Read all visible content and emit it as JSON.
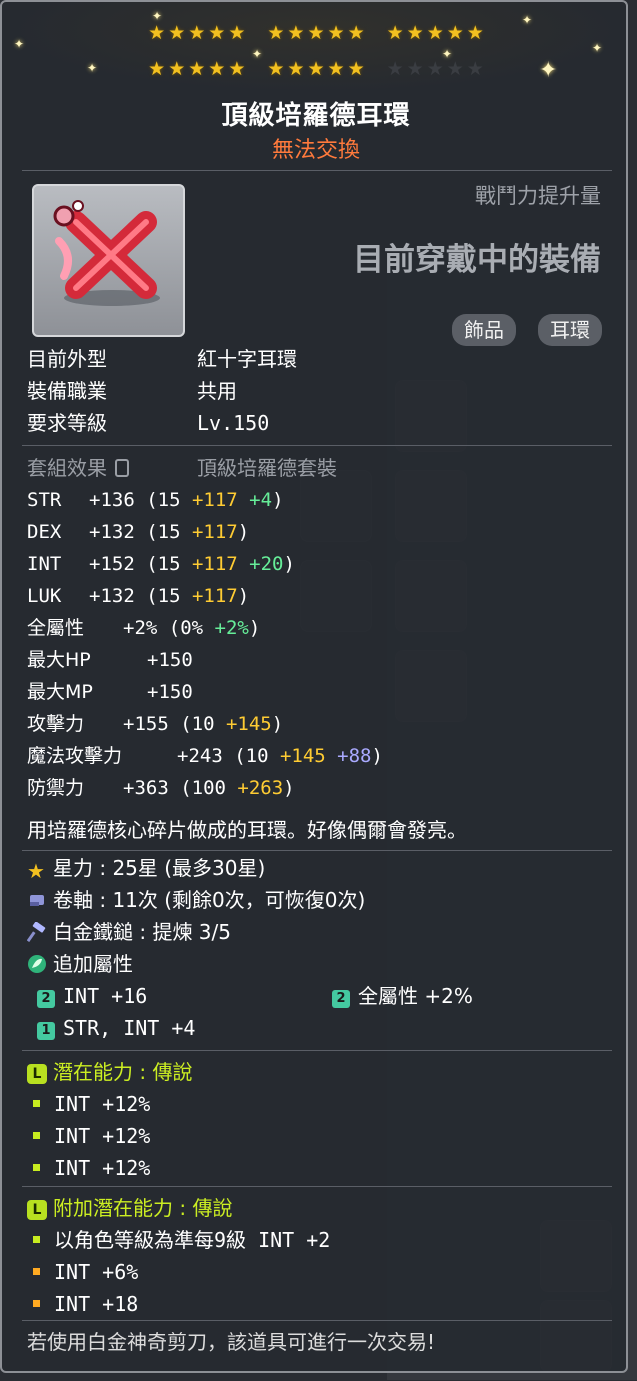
{
  "item": {
    "name": "頂級培羅德耳環",
    "trade_status": "無法交換",
    "combat_power_label": "戰鬥力提升量",
    "equipped_label": "目前穿戴中的裝備",
    "tags": [
      "飾品",
      "耳環"
    ],
    "star_force": {
      "filled": 25,
      "total": 30
    }
  },
  "info": {
    "appearance_label": "目前外型",
    "appearance_value": "紅十字耳環",
    "job_label": "裝備職業",
    "job_value": "共用",
    "level_label": "要求等級",
    "level_value": "Lv.150",
    "set_label": "套組效果",
    "set_value": "頂級培羅德套裝"
  },
  "stats": [
    {
      "name": "STR",
      "total": "+136",
      "base": "(15",
      "flame": "+117",
      "star": "+4",
      "close": ")"
    },
    {
      "name": "DEX",
      "total": "+132",
      "base": "(15",
      "flame": "+117",
      "close": ")"
    },
    {
      "name": "INT",
      "total": "+152",
      "base": "(15",
      "flame": "+117",
      "star": "+20",
      "close": ")"
    },
    {
      "name": "LUK",
      "total": "+132",
      "base": "(15",
      "flame": "+117",
      "close": ")"
    },
    {
      "name": "全屬性",
      "total": "+2%",
      "base": "(0%",
      "star": "+2%",
      "close": ")"
    },
    {
      "name": "最大HP",
      "total": "+150"
    },
    {
      "name": "最大MP",
      "total": "+150"
    },
    {
      "name": "攻擊力",
      "total": "+155",
      "base": "(10",
      "flame": "+145",
      "close": ")"
    },
    {
      "name": "魔法攻擊力",
      "total": "+243",
      "base": "(10",
      "flame": "+145",
      "enh": "+88",
      "close": ")"
    },
    {
      "name": "防禦力",
      "total": "+363",
      "base": "(100",
      "flame": "+263",
      "close": ")"
    }
  ],
  "description": "用培羅德核心碎片做成的耳環。好像偶爾會發亮。",
  "star_force_line": "星力 : 25星 (最多30星)",
  "scroll_line": "卷軸 : 11次 (剩餘0次，可恢復0次)",
  "hammer_line": "白金鐵鎚 : 提煉 3/5",
  "bonus_title": "追加屬性",
  "bonus": [
    {
      "tier": "2",
      "text": "INT  +16"
    },
    {
      "tier": "2",
      "text": "全屬性  +2%"
    },
    {
      "tier": "1",
      "text": "STR, INT  +4"
    }
  ],
  "potential": {
    "title": "潛在能力 : 傳說",
    "badge": "L",
    "lines": [
      "INT +12%",
      "INT +12%",
      "INT +12%"
    ]
  },
  "additional_potential": {
    "title": "附加潛在能力 : 傳說",
    "badge": "L",
    "lines": [
      "以角色等級為準每9級 INT +2",
      "INT +6%",
      "INT +18"
    ]
  },
  "footer": "若使用白金神奇剪刀，該道具可進行一次交易!"
}
